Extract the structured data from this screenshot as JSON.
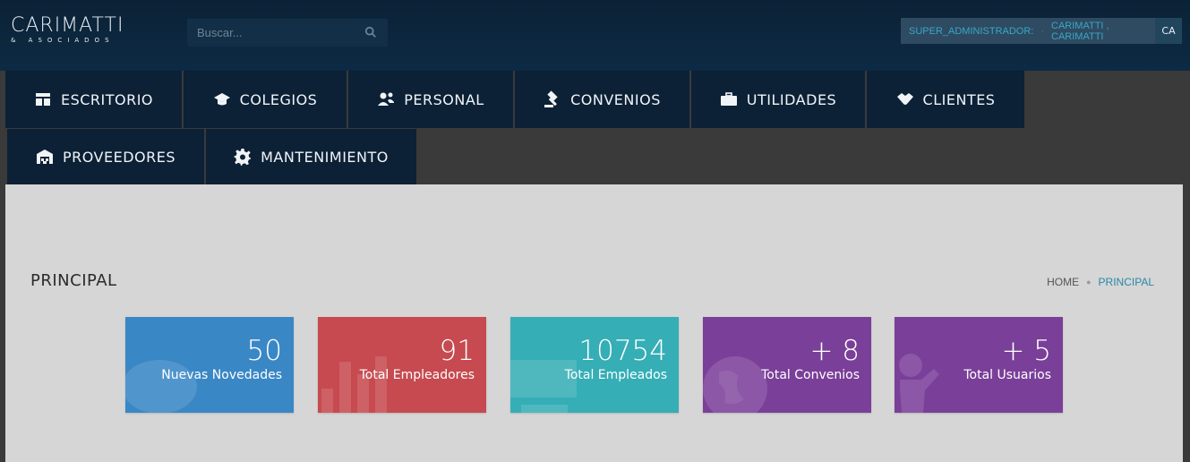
{
  "brand": {
    "main": "CARIMATTI",
    "sub": "& ASOCIADOS"
  },
  "search": {
    "placeholder": "Buscar..."
  },
  "user": {
    "role": "SUPER_ADMINISTRADOR:",
    "name": "CARIMATTI , CARIMATTI",
    "avatar": "CA"
  },
  "nav": [
    {
      "label": "ESCRITORIO",
      "icon": "dashboard-icon"
    },
    {
      "label": "COLEGIOS",
      "icon": "graduation-cap-icon"
    },
    {
      "label": "PERSONAL",
      "icon": "users-icon"
    },
    {
      "label": "CONVENIOS",
      "icon": "gavel-icon"
    },
    {
      "label": "UTILIDADES",
      "icon": "briefcase-icon"
    },
    {
      "label": "CLIENTES",
      "icon": "handshake-icon"
    },
    {
      "label": "PROVEEDORES",
      "icon": "warehouse-icon"
    },
    {
      "label": "MANTENIMIENTO",
      "icon": "gear-icon"
    }
  ],
  "page": {
    "title": "PRINCIPAL"
  },
  "breadcrumb": {
    "home": "HOME",
    "current": "PRINCIPAL"
  },
  "cards": [
    {
      "value": "50",
      "label": "Nuevas Novedades",
      "color": "#3a87c6",
      "icon": "chat-bubble-icon"
    },
    {
      "value": "91",
      "label": "Total Empleadores",
      "color": "#c64a4f",
      "icon": "bar-chart-icon"
    },
    {
      "value": "10754",
      "label": "Total Empleados",
      "color": "#35aeb6",
      "icon": "desktop-icon"
    },
    {
      "value": "+ 8",
      "label": "Total Convenios",
      "color": "#7a3f99",
      "icon": "globe-icon"
    },
    {
      "value": "+ 5",
      "label": "Total Usuarios",
      "color": "#7a3f99",
      "icon": "person-icon"
    }
  ]
}
